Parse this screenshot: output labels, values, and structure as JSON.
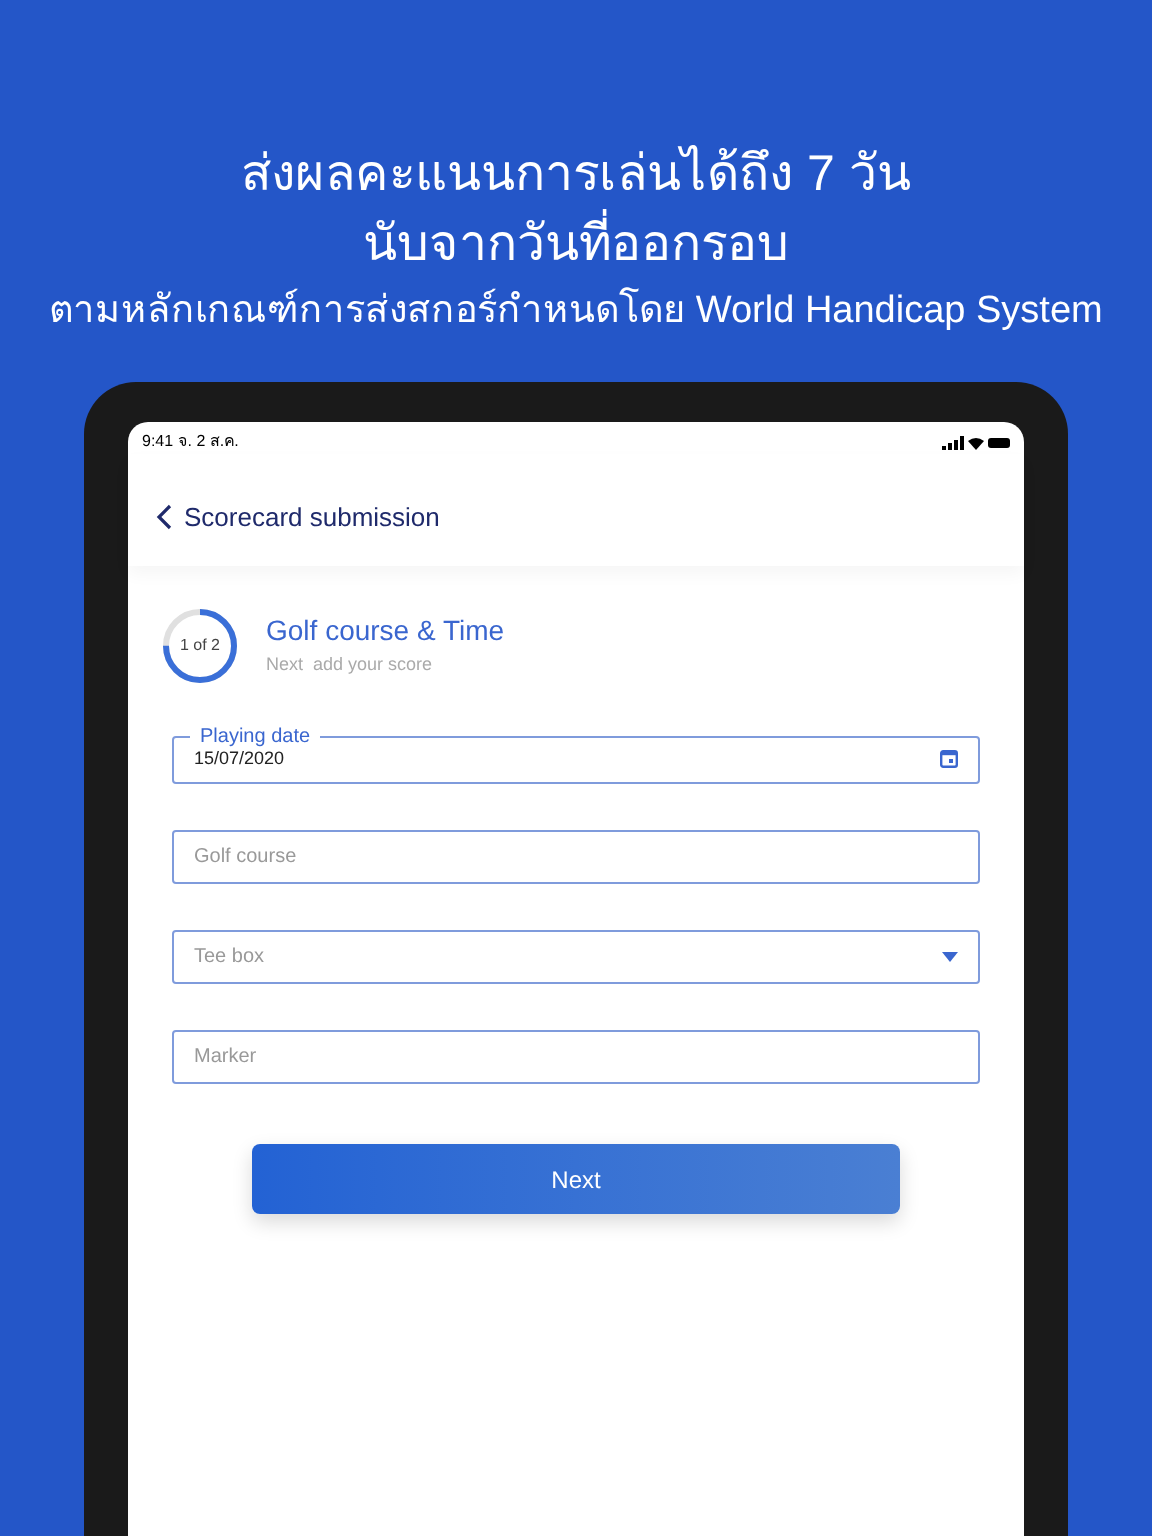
{
  "headline": [
    "ส่งผลคะแนนการเล่นได้ถึง 7 วัน",
    "นับจากวันที่ออกรอบ"
  ],
  "subheadline": "ตามหลักเกณฑ์การส่งสกอร์กำหนดโดย World Handicap System",
  "status_bar": {
    "time": "9:41 จ. 2 ส.ค."
  },
  "header": {
    "title": "Scorecard submission"
  },
  "step": {
    "counter": "1 of 2",
    "level": 0.75,
    "title": "Golf course & Time",
    "subtitle": "Next  add your score"
  },
  "fields": [
    {
      "kind": "date",
      "label": "Playing date",
      "value": "15/07/2020"
    },
    {
      "kind": "text",
      "placeholder": "Golf course"
    },
    {
      "kind": "select",
      "placeholder": "Tee box"
    },
    {
      "kind": "text",
      "placeholder": "Marker"
    }
  ],
  "button": "Next"
}
